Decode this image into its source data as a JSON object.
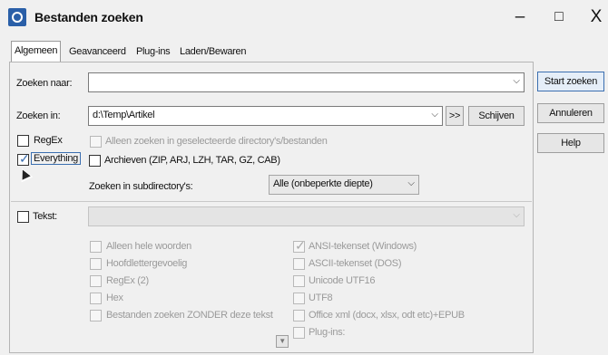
{
  "window": {
    "title": "Bestanden zoeken",
    "minimize": "–",
    "maximize": "□",
    "close": "X"
  },
  "tabs": [
    {
      "label": "Algemeen",
      "active": true
    },
    {
      "label": "Geavanceerd",
      "active": false
    },
    {
      "label": "Plug-ins",
      "active": false
    },
    {
      "label": "Laden/Bewaren",
      "active": false
    }
  ],
  "search": {
    "name_label": "Zoeken naar:",
    "name_value": "",
    "in_label": "Zoeken in:",
    "in_value": "d:\\Temp\\Artikel",
    "expand_btn": ">>",
    "drives_btn": "Schijven"
  },
  "options": {
    "regex_label": "RegEx",
    "everything_label": "Everything",
    "selected_only_label": "Alleen zoeken in geselecteerde directory's/bestanden",
    "archives_label": "Archieven (ZIP, ARJ, LZH, TAR, GZ, CAB)",
    "subdir_label": "Zoeken in subdirectory's:",
    "subdir_value": "Alle (onbeperkte diepte)"
  },
  "text_section": {
    "text_label": "Tekst:",
    "text_value": "",
    "left_options": [
      "Alleen hele woorden",
      "Hoofdlettergevoelig",
      "RegEx (2)",
      "Hex",
      "Bestanden zoeken ZONDER deze tekst"
    ],
    "right_options": [
      "ANSI-tekenset (Windows)",
      "ASCII-tekenset (DOS)",
      "Unicode UTF16",
      "UTF8",
      "Office xml (docx, xlsx, odt etc)+EPUB",
      "Plug-ins:"
    ]
  },
  "side_buttons": {
    "start": "Start zoeken",
    "cancel": "Annuleren",
    "help": "Help"
  },
  "colors": {
    "accent": "#3b6fb0",
    "icon": "#2a5fa8"
  }
}
